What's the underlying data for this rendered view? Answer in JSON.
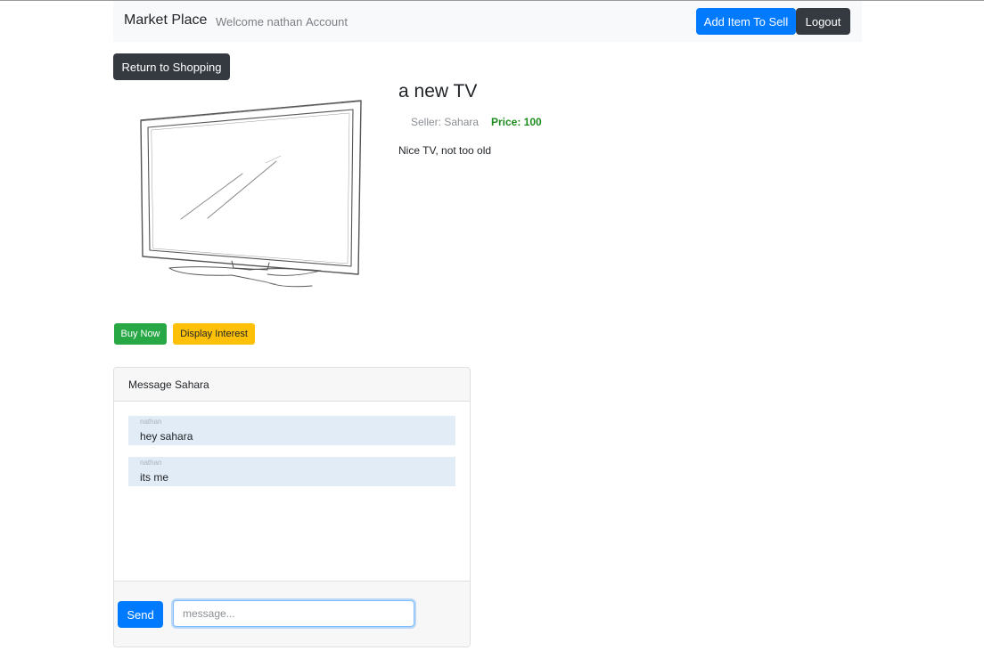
{
  "navbar": {
    "brand": "Market Place",
    "welcome": "Welcome nathan",
    "account": "Account",
    "add_item": "Add Item To Sell",
    "logout": "Logout"
  },
  "return_button": "Return to Shopping",
  "product": {
    "title": "a new TV",
    "seller": "Seller: Sahara",
    "price": "Price: 100",
    "description": "Nice TV, not too old",
    "image_icon": "tv-sketch-image"
  },
  "actions": {
    "buy_now": "Buy Now",
    "display_interest": "Display Interest"
  },
  "messages": {
    "header": "Message Sahara",
    "items": [
      {
        "author": "nathan",
        "text": "hey sahara"
      },
      {
        "author": "nathan",
        "text": "its me"
      }
    ],
    "send": "Send",
    "input_placeholder": "message...",
    "input_value": ""
  },
  "colors": {
    "primary": "#007bff",
    "dark": "#343a40",
    "success": "#28a745",
    "warning": "#ffc107",
    "price": "#1e8b1e",
    "message_bg": "#e2ecf6"
  }
}
